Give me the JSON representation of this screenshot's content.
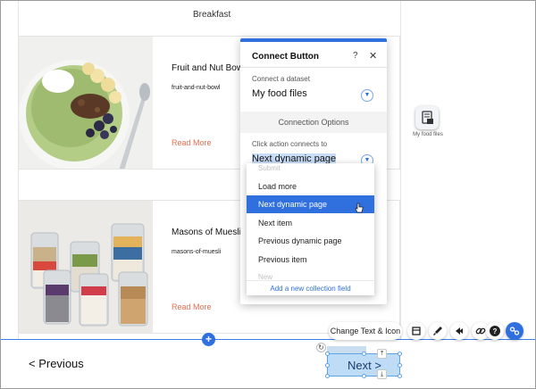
{
  "header": {
    "title": "Breakfast"
  },
  "cards": [
    {
      "title": "Fruit and Nut Bowl",
      "slug": "fruit-and-nut-bowl",
      "link": "Read More"
    },
    {
      "title": "Masons of Muesli",
      "slug": "masons-of-muesli",
      "link": "Read More"
    }
  ],
  "pagination": {
    "previous": "< Previous",
    "next": "Next >"
  },
  "dataset_icon": {
    "label": "My food files",
    "icon": "dataset-icon"
  },
  "toolbar": {
    "main_label": "Change Text & Icon",
    "buttons": [
      "layout-icon",
      "brush-icon",
      "animation-icon",
      "link-icon",
      "help-icon",
      "connect-icon"
    ],
    "help_glyph": "?"
  },
  "panel": {
    "title": "Connect Button",
    "help": "?",
    "close": "✕",
    "dataset_label": "Connect a dataset",
    "dataset_value": "My food files",
    "section_label": "Connection Options",
    "action_label": "Click action connects to",
    "action_value": "Next dynamic page"
  },
  "dropdown": {
    "items": [
      {
        "label": "Submit",
        "state": "faded"
      },
      {
        "label": "Load more",
        "state": "normal"
      },
      {
        "label": "Next dynamic page",
        "state": "selected"
      },
      {
        "label": "Next item",
        "state": "normal"
      },
      {
        "label": "Previous dynamic page",
        "state": "normal"
      },
      {
        "label": "Previous item",
        "state": "normal"
      },
      {
        "label": "New",
        "state": "faded"
      }
    ],
    "add_label": "Add a new collection field"
  },
  "colors": {
    "accent": "#2f6fde",
    "link": "#e07052"
  }
}
